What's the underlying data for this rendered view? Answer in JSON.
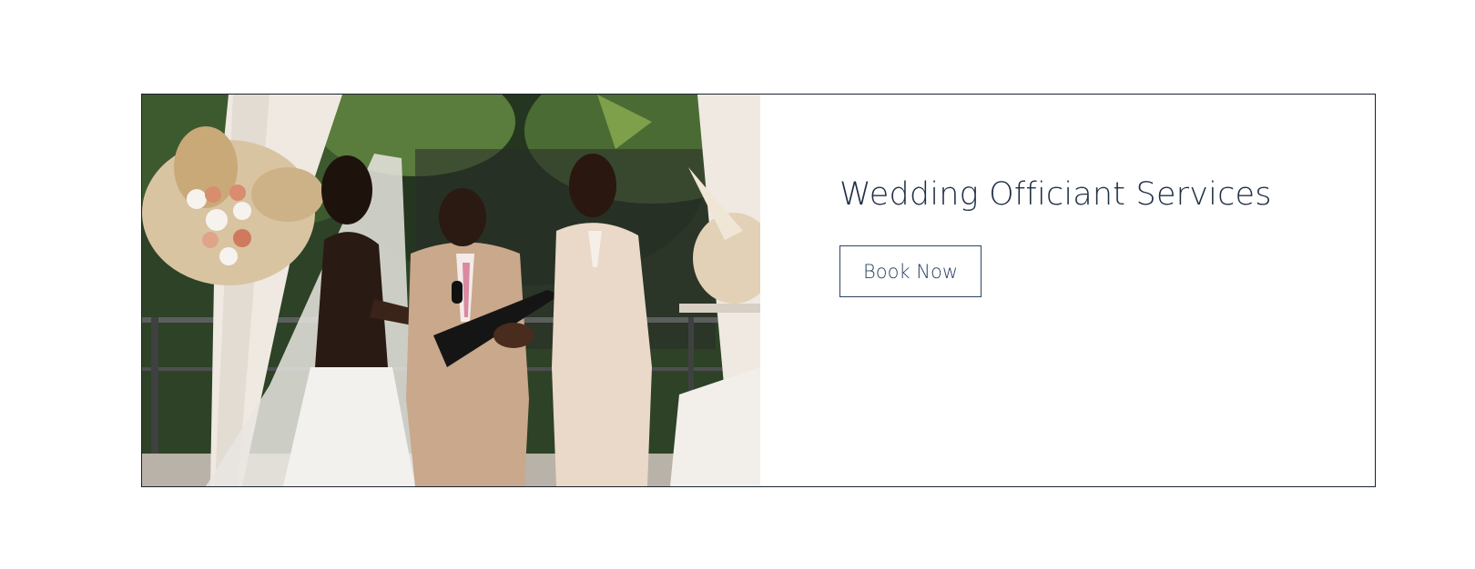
{
  "service_card": {
    "photo": {
      "subject": "wedding-ceremony-photo"
    },
    "title": "Wedding Officiant Services",
    "book_button_label": "Book Now",
    "colors": {
      "title_text": "#1f2e45",
      "button_border": "#2b4363",
      "card_border": "#1b2330"
    }
  }
}
